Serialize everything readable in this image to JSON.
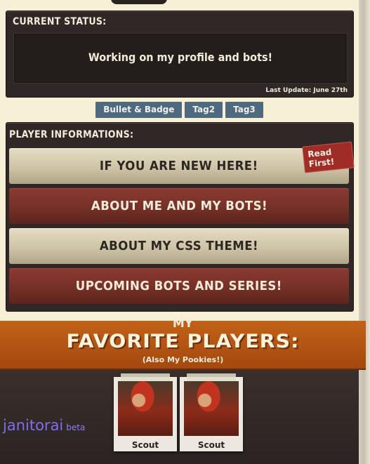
{
  "status": {
    "title": "CURRENT STATUS:",
    "text": "Working on my profile and bots!",
    "last_update": "Last Update: June 27th"
  },
  "tags": [
    "Bullet & Badge",
    "Tag2",
    "Tag3"
  ],
  "player_info": {
    "title": "PLAYER INFORMATIONS:",
    "badge": "Read First!",
    "buttons": [
      "IF YOU ARE NEW HERE!",
      "ABOUT ME AND MY BOTS!",
      "ABOUT MY CSS THEME!",
      "UPCOMING BOTS AND SERIES!"
    ]
  },
  "favorites": {
    "my": "MY",
    "title": "FAVORITE PLAYERS:",
    "subtitle": "(Also My Pookies!)",
    "players": [
      {
        "name": "Scout"
      },
      {
        "name": "Scout"
      }
    ]
  },
  "brand": {
    "name": "janitorai",
    "badge": "beta"
  },
  "colors": {
    "background": "#f7f0d6",
    "panel": "#2f2826",
    "tag": "#4d6a80",
    "button_light": "#d6ccb1",
    "button_dark": "#7a3128",
    "banner": "#b3541a",
    "brand": "#7d6df0"
  }
}
